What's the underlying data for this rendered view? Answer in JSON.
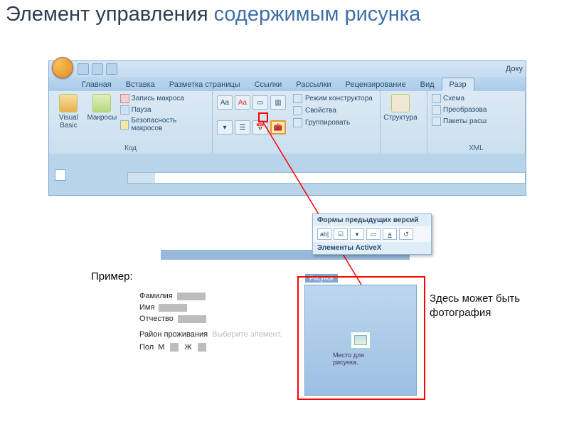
{
  "title": {
    "part1": "Элемент управления ",
    "part2": "содержимым рисунка"
  },
  "titlebar": {
    "doc": "Доку"
  },
  "tabs": {
    "home": "Главная",
    "insert": "Вставка",
    "layout": "Разметка страницы",
    "refs": "Ссылки",
    "mail": "Рассылки",
    "review": "Рецензирование",
    "view": "Вид",
    "dev": "Разр"
  },
  "code_group": {
    "vb": "Visual Basic",
    "macros": "Макросы",
    "record": "Запись макроса",
    "pause": "Пауза",
    "security": "Безопасность макросов",
    "title": "Код"
  },
  "controls_group": {
    "aa_big": "Aa",
    "aa_small": "Aa",
    "design_mode": "Режим конструктора",
    "properties": "Свойства",
    "group": "Группировать"
  },
  "struct_group": {
    "label": "Структура"
  },
  "xml_group": {
    "schema": "Схема",
    "transform": "Преобразова",
    "packs": "Пакеты расш",
    "title": "XML"
  },
  "dropdown": {
    "legacy_header": "Формы предыдущих версий",
    "ab": "ab|",
    "a_u": "a",
    "activex_header": "Элементы ActiveX"
  },
  "example": {
    "label": "Пример:",
    "surname": "Фамилия",
    "name": "Имя",
    "patronymic": "Отчество",
    "district": "Район проживания",
    "district_hint": "Выберите элемент.",
    "sex": "Пол",
    "m": "М",
    "f": "Ж"
  },
  "picture_control": {
    "tab": "Рисунок",
    "placeholder": "Место для рисунка."
  },
  "side_annotation": "Здесь может быть фотография"
}
